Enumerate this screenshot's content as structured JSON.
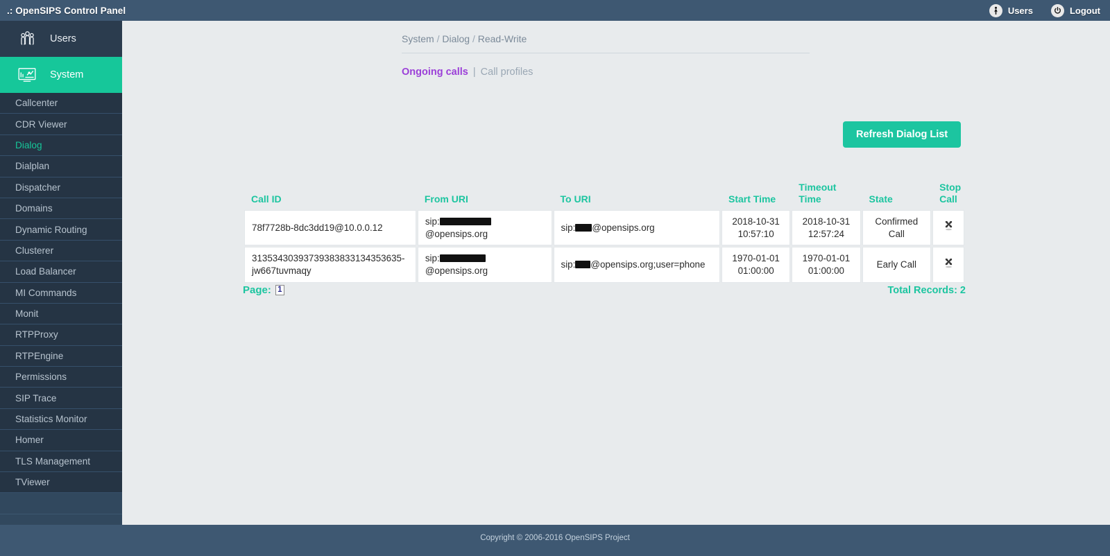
{
  "topbar": {
    "title": ".: OpenSIPS Control Panel",
    "users_label": "Users",
    "logout_label": "Logout"
  },
  "sidebar": {
    "primary": [
      {
        "label": "Users",
        "icon": "users-group-icon",
        "active": false
      },
      {
        "label": "System",
        "icon": "monitor-chart-icon",
        "active": true
      }
    ],
    "items": [
      {
        "label": "Callcenter"
      },
      {
        "label": "CDR Viewer"
      },
      {
        "label": "Dialog"
      },
      {
        "label": "Dialplan"
      },
      {
        "label": "Dispatcher"
      },
      {
        "label": "Domains"
      },
      {
        "label": "Dynamic Routing"
      },
      {
        "label": "Clusterer"
      },
      {
        "label": "Load Balancer"
      },
      {
        "label": "MI Commands"
      },
      {
        "label": "Monit"
      },
      {
        "label": "RTPProxy"
      },
      {
        "label": "RTPEngine"
      },
      {
        "label": "Permissions"
      },
      {
        "label": "SIP Trace"
      },
      {
        "label": "Statistics Monitor"
      },
      {
        "label": "Homer"
      },
      {
        "label": "TLS Management"
      },
      {
        "label": "TViewer"
      }
    ],
    "active_item": "Dialog"
  },
  "breadcrumb": {
    "part1": "System",
    "sep1": "/",
    "part2": "Dialog",
    "sep2": "/",
    "part3": "Read-Write"
  },
  "tabs": {
    "active_label": "Ongoing calls",
    "separator": "|",
    "idle_label": "Call profiles"
  },
  "toolbar": {
    "refresh_label": "Refresh Dialog List"
  },
  "table": {
    "headers": {
      "call_id": "Call ID",
      "from_uri": "From URI",
      "to_uri": "To URI",
      "start_time": "Start Time",
      "timeout_time": "Timeout Time",
      "state": "State",
      "stop_call": "Stop Call"
    },
    "rows": [
      {
        "call_id": "78f7728b-8dc3dd19@10.0.0.12",
        "from_uri_prefix": "sip:",
        "from_uri_suffix": "@opensips.org",
        "to_uri_prefix": "sip:",
        "to_uri_suffix": "@opensips.org",
        "start_time": "2018-10-31 10:57:10",
        "timeout_time": "2018-10-31 12:57:24",
        "state": "Confirmed Call",
        "stop_icon": "stop-call-icon"
      },
      {
        "call_id": "31353430393739383833134353635-jw667tuvmaqy",
        "from_uri_prefix": "sip:",
        "from_uri_suffix": "@opensips.org",
        "to_uri_prefix": "sip:",
        "to_uri_suffix": "@opensips.org;user=phone",
        "start_time": "1970-01-01 01:00:00",
        "timeout_time": "1970-01-01 01:00:00",
        "state": "Early Call",
        "stop_icon": "stop-call-icon"
      }
    ]
  },
  "pagination": {
    "page_label": "Page:",
    "current_page": "1",
    "total_records": "Total Records: 2"
  },
  "footer": {
    "copyright": "Copyright © 2006-2016 OpenSIPS Project"
  },
  "colors": {
    "accent_green": "#1cc5a0",
    "topbar_blue": "#3e5872",
    "sidebar_dark": "#253444",
    "tab_purple": "#9b3fd8"
  }
}
